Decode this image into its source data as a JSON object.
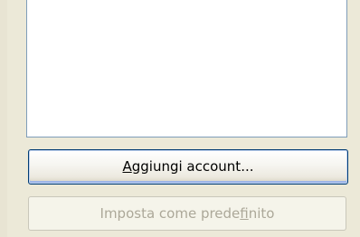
{
  "account_panel": {
    "add_account_button": {
      "mnemonic": "A",
      "rest": "ggiungi account..."
    },
    "set_default_button": {
      "before": "Imposta come prede",
      "mnemonic": "f",
      "after": "inito",
      "enabled": false
    }
  }
}
